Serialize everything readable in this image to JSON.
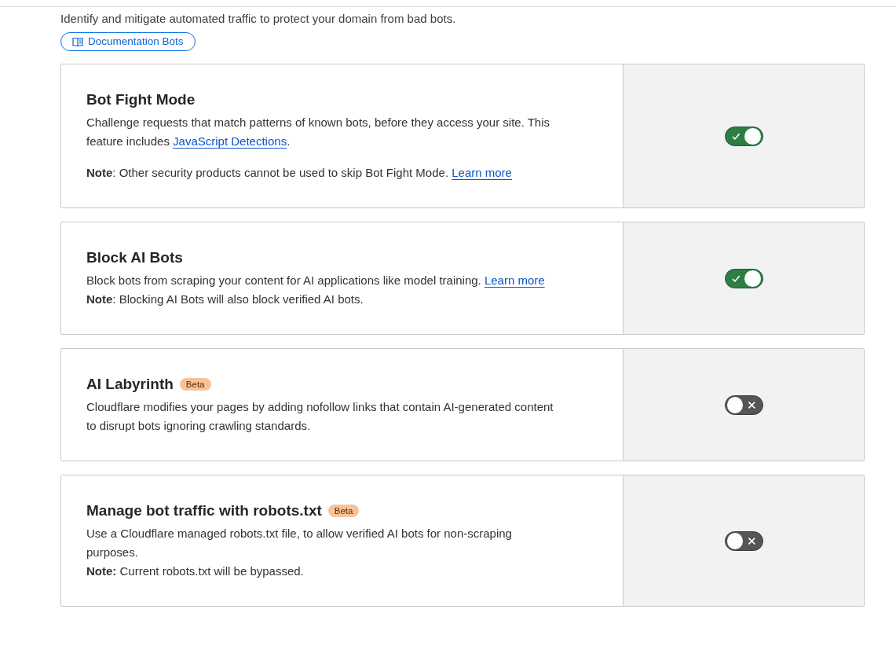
{
  "intro": "Identify and mitigate automated traffic to protect your domain from bad bots.",
  "doc_button": {
    "label": "Documentation Bots"
  },
  "cards": [
    {
      "title": "Bot Fight Mode",
      "on": true,
      "blocks": [
        [
          [
            {
              "kind": "text",
              "text": "Challenge requests that match patterns of known bots, before they access your site. This feature includes "
            },
            {
              "kind": "link",
              "text": "JavaScript Detections"
            },
            {
              "kind": "text",
              "text": "."
            }
          ]
        ],
        [
          [
            {
              "kind": "text",
              "text": "**Note**: Other security products cannot be used to skip Bot Fight Mode. "
            },
            {
              "kind": "link",
              "text": "Learn more"
            }
          ]
        ]
      ]
    },
    {
      "title": "Block AI Bots",
      "on": true,
      "blocks": [
        [
          [
            {
              "kind": "text",
              "text": "Block bots from scraping your content for AI applications like model training. "
            },
            {
              "kind": "link",
              "text": "Learn more"
            }
          ],
          [
            {
              "kind": "text",
              "text": "**Note**: Blocking AI Bots will also block verified AI bots."
            }
          ]
        ]
      ]
    },
    {
      "title": "AI Labyrinth",
      "badge": "Beta",
      "on": false,
      "blocks": [
        [
          [
            {
              "kind": "text",
              "text": "Cloudflare modifies your pages by adding nofollow links that contain AI-generated content to disrupt bots ignoring crawling standards."
            }
          ]
        ]
      ]
    },
    {
      "title": "Manage bot traffic with robots.txt",
      "badge": "Beta",
      "on": false,
      "blocks": [
        [
          [
            {
              "kind": "text",
              "text": "Use a Cloudflare managed robots.txt file, to allow verified AI bots for non-scraping purposes."
            }
          ],
          [
            {
              "kind": "text",
              "text": "**Note:** Current robots.txt will be bypassed."
            }
          ]
        ]
      ]
    }
  ]
}
